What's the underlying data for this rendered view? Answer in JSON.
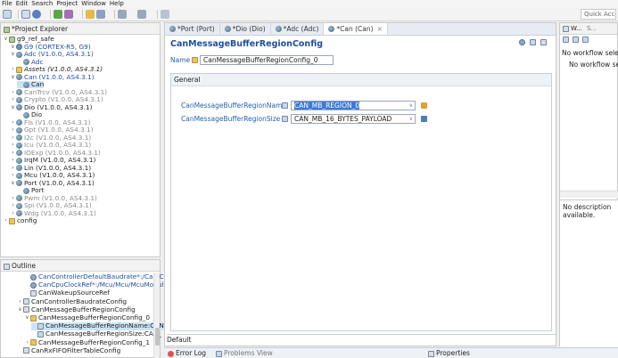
{
  "menubar": [
    "File",
    "Edit",
    "Search",
    "Project",
    "Window",
    "Help"
  ],
  "quick_access": "Quick Access",
  "project_explorer": {
    "title": "*Project Explorer",
    "rows": [
      {
        "indent": 0,
        "twisty": "down",
        "icon": "proj",
        "label": "g9_ref_safe",
        "style": ""
      },
      {
        "indent": 1,
        "twisty": "down",
        "icon": "cfg",
        "label": "G9 (CORTEX-R5, G9)",
        "style": "b"
      },
      {
        "indent": 1,
        "twisty": "down",
        "icon": "mod",
        "label": "Adc (V1.0.0, AS4.3.1)",
        "style": "b"
      },
      {
        "indent": 2,
        "twisty": "",
        "icon": "mod",
        "label": "Adc",
        "style": "b"
      },
      {
        "indent": 1,
        "twisty": "right",
        "icon": "fold",
        "label": "Assets (V1.0.0, AS4.3.1)",
        "style": "i"
      },
      {
        "indent": 1,
        "twisty": "down",
        "icon": "mod",
        "label": "Can (V1.0.0, AS4.3.1)",
        "style": "b"
      },
      {
        "indent": 2,
        "twisty": "",
        "icon": "mod",
        "label": "Can",
        "style": "sel"
      },
      {
        "indent": 1,
        "twisty": "right",
        "icon": "mod",
        "label": "CanTrcv (V1.0.0, AS4.3.1)",
        "style": "g"
      },
      {
        "indent": 1,
        "twisty": "right",
        "icon": "mod",
        "label": "Crypto (V1.0.0, AS4.3.1)",
        "style": "g"
      },
      {
        "indent": 1,
        "twisty": "down",
        "icon": "mod",
        "label": "Dio (V1.0.0, AS4.3.1)",
        "style": ""
      },
      {
        "indent": 2,
        "twisty": "",
        "icon": "mod",
        "label": "Dio",
        "style": ""
      },
      {
        "indent": 1,
        "twisty": "right",
        "icon": "mod",
        "label": "Fls (V1.0.0, AS4.3.1)",
        "style": "g"
      },
      {
        "indent": 1,
        "twisty": "right",
        "icon": "mod",
        "label": "Gpt (V1.0.0, AS4.3.1)",
        "style": "g"
      },
      {
        "indent": 1,
        "twisty": "right",
        "icon": "mod",
        "label": "I2c (V1.0.0, AS4.3.1)",
        "style": "g"
      },
      {
        "indent": 1,
        "twisty": "right",
        "icon": "mod",
        "label": "Icu (V1.0.0, AS4.3.1)",
        "style": "g"
      },
      {
        "indent": 1,
        "twisty": "right",
        "icon": "mod",
        "label": "IOExp (V1.0.0, AS4.3.1)",
        "style": "g"
      },
      {
        "indent": 1,
        "twisty": "right",
        "icon": "mod",
        "label": "IrqM (V1.0.0, AS4.3.1)",
        "style": ""
      },
      {
        "indent": 1,
        "twisty": "right",
        "icon": "mod",
        "label": "Lin (V1.0.0, AS4.3.1)",
        "style": ""
      },
      {
        "indent": 1,
        "twisty": "right",
        "icon": "mod",
        "label": "Mcu (V1.0.0, AS4.3.1)",
        "style": ""
      },
      {
        "indent": 1,
        "twisty": "down",
        "icon": "mod",
        "label": "Port (V1.0.0, AS4.3.1)",
        "style": ""
      },
      {
        "indent": 2,
        "twisty": "",
        "icon": "mod",
        "label": "Port",
        "style": ""
      },
      {
        "indent": 1,
        "twisty": "right",
        "icon": "mod",
        "label": "Pwm (V1.0.0, AS4.3.1)",
        "style": "g"
      },
      {
        "indent": 1,
        "twisty": "right",
        "icon": "mod",
        "label": "Spi (V1.0.0, AS4.3.1)",
        "style": "g"
      },
      {
        "indent": 1,
        "twisty": "right",
        "icon": "mod",
        "label": "Wdg (V1.0.0, AS4.3.1)",
        "style": "g"
      },
      {
        "indent": 0,
        "twisty": "right",
        "icon": "fold",
        "label": "config",
        "style": ""
      }
    ]
  },
  "outline": {
    "title": "Outline",
    "rows": [
      {
        "indent": 3,
        "twisty": "",
        "icon": "ref",
        "label": "CanControllerDefaultBaudrate*:/Can/Can,",
        "style": "b"
      },
      {
        "indent": 3,
        "twisty": "",
        "icon": "ref",
        "label": "CanCpuClockRef*:/Mcu/Mcu/McuModule",
        "style": "b"
      },
      {
        "indent": 3,
        "twisty": "",
        "icon": "cont",
        "label": "CanWakeupSourceRef",
        "style": ""
      },
      {
        "indent": 2,
        "twisty": "right",
        "icon": "cont",
        "label": "CanControllerBaudrateConfig",
        "style": ""
      },
      {
        "indent": 2,
        "twisty": "down",
        "icon": "cont",
        "label": "CanMessageBufferRegionConfig",
        "style": ""
      },
      {
        "indent": 3,
        "twisty": "down",
        "icon": "fold",
        "label": "CanMessageBufferRegionConfig_0",
        "style": ""
      },
      {
        "indent": 4,
        "twisty": "",
        "icon": "par",
        "label": "CanMessageBufferRegionName:CAN",
        "style": "sel"
      },
      {
        "indent": 4,
        "twisty": "",
        "icon": "par",
        "label": "CanMessageBufferRegionSize:CAN_",
        "style": ""
      },
      {
        "indent": 3,
        "twisty": "right",
        "icon": "fold",
        "label": "CanMessageBufferRegionConfig_1",
        "style": ""
      },
      {
        "indent": 2,
        "twisty": "",
        "icon": "cont",
        "label": "CanRxFIFOFilterTableConfig",
        "style": ""
      }
    ]
  },
  "editor": {
    "tabs": [
      {
        "label": "*Port (Port)",
        "active": false
      },
      {
        "label": "*Dio (Dio)",
        "active": false
      },
      {
        "label": "*Adc (Adc)",
        "active": false
      },
      {
        "label": "*Can (Can)",
        "active": true
      }
    ],
    "title": "CanMessageBufferRegionConfig",
    "name_label": "Name",
    "name_value": "CanMessageBufferRegionConfig_0",
    "section_tab": "General",
    "params": [
      {
        "label": "CanMessageBufferRegionName",
        "value": "CAN_MB_REGION_0",
        "selected": true
      },
      {
        "label": "CanMessageBufferRegionSize",
        "value": "CAN_MB_16_BYTES_PAYLOAD",
        "selected": false
      }
    ],
    "bottom_tab": "Default"
  },
  "right_panel": {
    "tabs": [
      "W...",
      "S..."
    ],
    "msg_top": "No workflow selecte",
    "msg_item": "No workflow sele",
    "desc": "No description available."
  },
  "bottom_views": {
    "error_log": "Error Log",
    "problems": "Problems View",
    "properties": "Properties"
  }
}
